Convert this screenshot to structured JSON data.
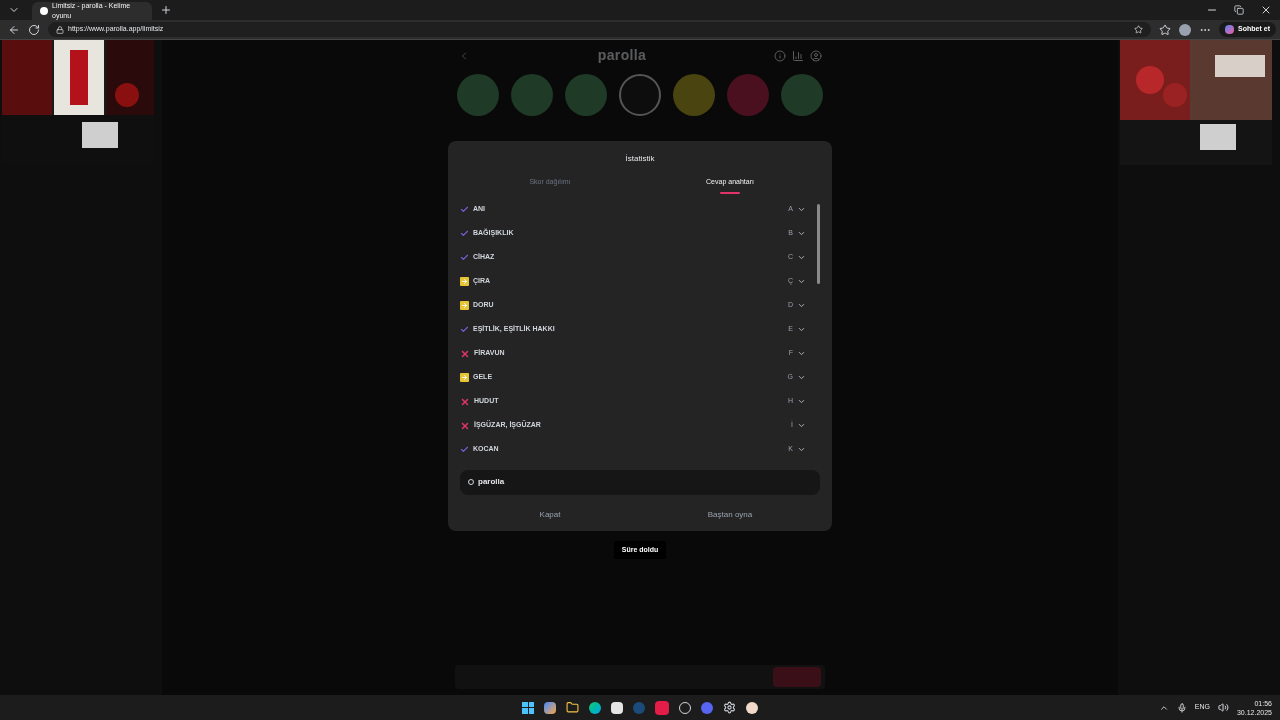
{
  "browser": {
    "tab_title": "Limitsiz - parolla - Kelime oyunu",
    "url": "https://www.parolla.app/limitsiz",
    "copilot_label": "Sohbet et"
  },
  "game": {
    "logo": "parolla",
    "circles": [
      {
        "color": "#1f3a26",
        "selected": false
      },
      {
        "color": "#1f3a26",
        "selected": false
      },
      {
        "color": "#1f3a26",
        "selected": false
      },
      {
        "color": "#0d0d0d",
        "selected": true
      },
      {
        "color": "#4a4410",
        "selected": false
      },
      {
        "color": "#4a1020",
        "selected": false
      },
      {
        "color": "#1f3a26",
        "selected": false
      }
    ]
  },
  "dialog": {
    "title": "İstatistik",
    "tabs": [
      {
        "label": "Skor dağılımı",
        "selected": false
      },
      {
        "label": "Cevap anahtarı",
        "selected": true
      }
    ],
    "answers": [
      {
        "word": "ANI",
        "letter": "A",
        "kind": "correct"
      },
      {
        "word": "BAĞIŞIKLIK",
        "letter": "B",
        "kind": "correct"
      },
      {
        "word": "CİHAZ",
        "letter": "C",
        "kind": "correct"
      },
      {
        "word": "ÇIRA",
        "letter": "Ç",
        "kind": "pass"
      },
      {
        "word": "DORU",
        "letter": "D",
        "kind": "pass"
      },
      {
        "word": "EŞİTLİK, EŞİTLİK HAKKI",
        "letter": "E",
        "kind": "correct"
      },
      {
        "word": "FİRAVUN",
        "letter": "F",
        "kind": "wrong"
      },
      {
        "word": "GELE",
        "letter": "G",
        "kind": "pass"
      },
      {
        "word": "HUDUT",
        "letter": "H",
        "kind": "wrong"
      },
      {
        "word": "İŞGÜZAR, İŞGÜZAR",
        "letter": "İ",
        "kind": "wrong"
      },
      {
        "word": "KOCAN",
        "letter": "K",
        "kind": "correct"
      }
    ],
    "share_text": "parolla",
    "buttons": [
      "Kapat",
      "Baştan oyna"
    ]
  },
  "toast": "Süre doldu",
  "taskbar": {
    "language": "ENG",
    "time": "01:56",
    "date": "30.12.2025"
  }
}
